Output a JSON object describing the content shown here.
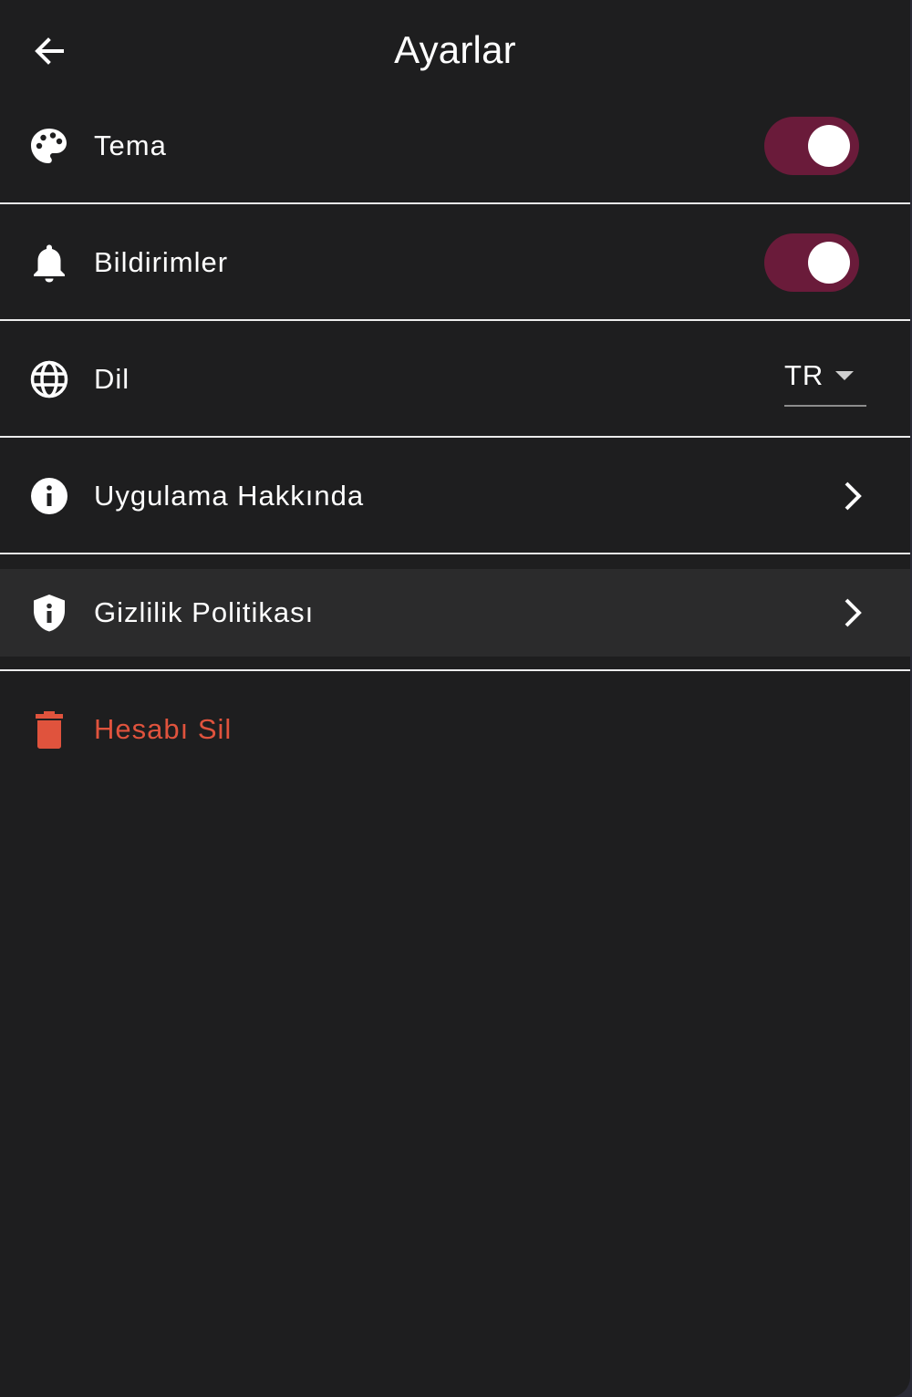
{
  "app_bar": {
    "title": "Ayarlar",
    "back_icon": "arrow-back-icon"
  },
  "settings": {
    "theme": {
      "label": "Tema",
      "icon": "palette-icon",
      "enabled": true
    },
    "notifications": {
      "label": "Bildirimler",
      "icon": "bell-icon",
      "enabled": true
    },
    "language": {
      "label": "Dil",
      "icon": "globe-icon",
      "selected": "TR"
    },
    "about": {
      "label": "Uygulama Hakkında",
      "icon": "info-icon",
      "trailing_icon": "chevron-right-icon"
    },
    "privacy": {
      "label": "Gizlilik Politikası",
      "icon": "shield-info-icon",
      "trailing_icon": "chevron-right-icon"
    },
    "delete_account": {
      "label": "Hesabı Sil",
      "icon": "trash-icon"
    }
  },
  "colors": {
    "background": "#1e1e1f",
    "toggle_track": "#6a1b3a",
    "danger": "#e0533d",
    "highlight_row": "#2b2b2c"
  }
}
